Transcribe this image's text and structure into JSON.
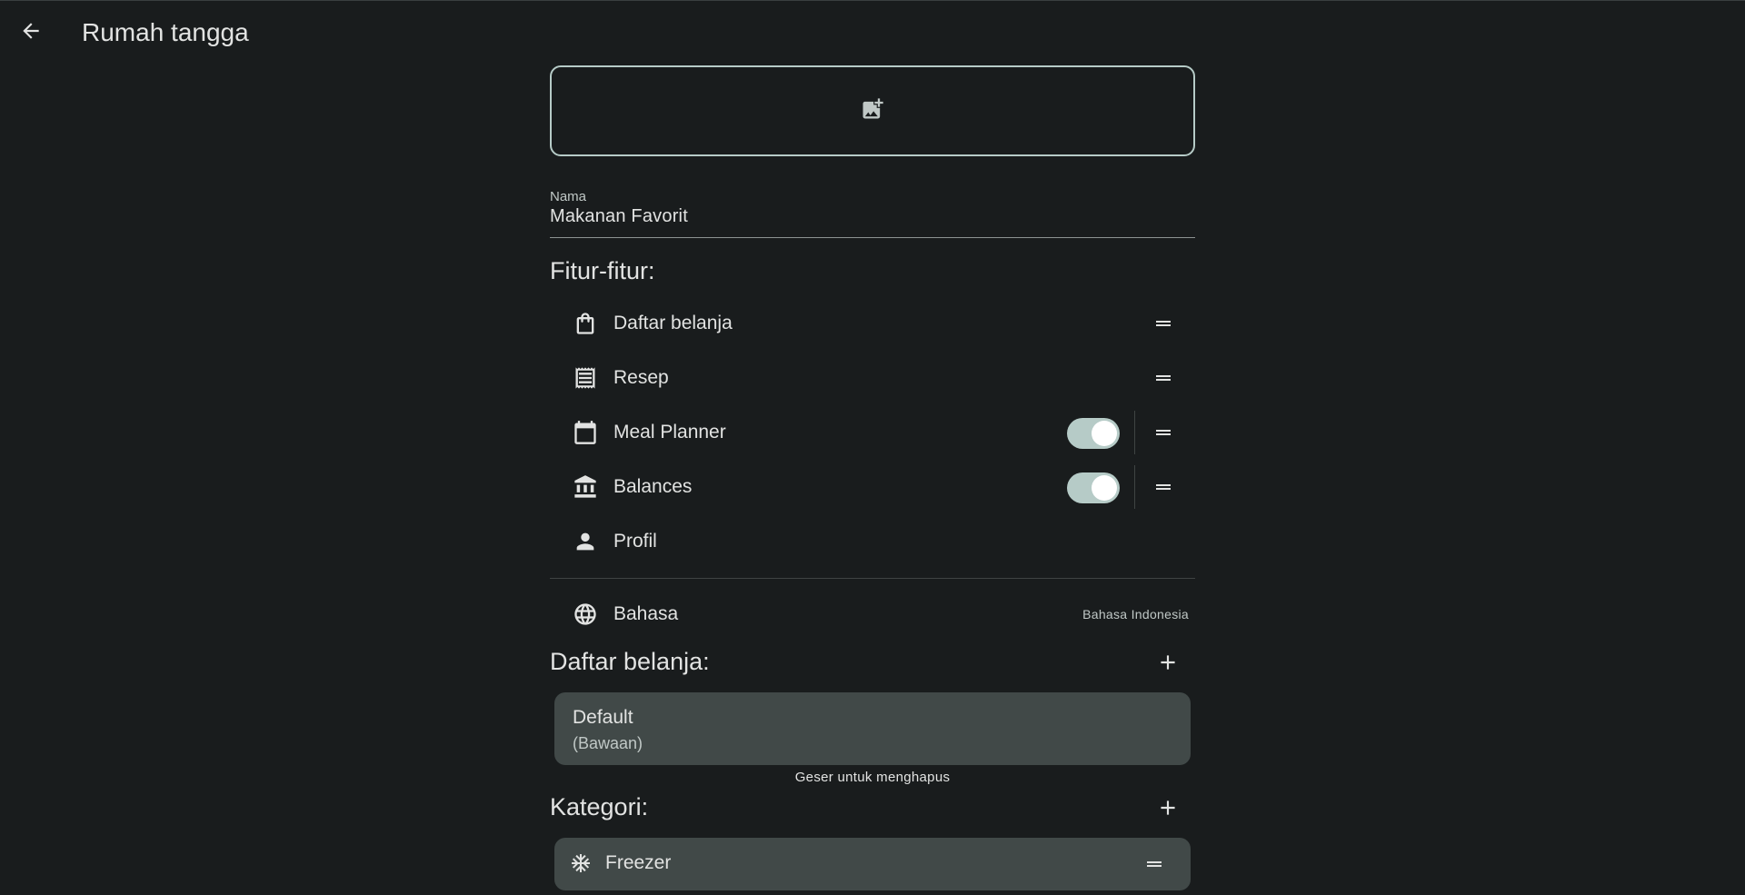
{
  "appbar": {
    "title": "Rumah tangga",
    "back_icon": "arrow-left-icon"
  },
  "image_picker": {
    "icon": "add-photo-icon"
  },
  "name_field": {
    "label": "Nama",
    "value": "Makanan Favorit"
  },
  "features": {
    "heading": "Fitur-fitur:",
    "items": [
      {
        "label": "Daftar belanja",
        "icon": "shopping-bag-icon",
        "toggle": null,
        "draggable": true
      },
      {
        "label": "Resep",
        "icon": "receipt-icon",
        "toggle": null,
        "draggable": true
      },
      {
        "label": "Meal Planner",
        "icon": "calendar-icon",
        "toggle": true,
        "draggable": true
      },
      {
        "label": "Balances",
        "icon": "bank-icon",
        "toggle": true,
        "draggable": true
      },
      {
        "label": "Profil",
        "icon": "person-icon",
        "toggle": null,
        "draggable": false
      }
    ]
  },
  "language": {
    "label": "Bahasa",
    "value": "Bahasa Indonesia",
    "icon": "globe-icon"
  },
  "shopping_lists": {
    "heading": "Daftar belanja:",
    "items": [
      {
        "title": "Default",
        "subtitle": "(Bawaan)"
      }
    ],
    "hint": "Geser untuk menghapus"
  },
  "categories": {
    "heading": "Kategori:",
    "items": [
      {
        "label": "Freezer",
        "icon": "snowflake-icon"
      }
    ]
  },
  "colors": {
    "background": "#191c1d",
    "accent": "#b6cbc7",
    "card": "#414948"
  }
}
